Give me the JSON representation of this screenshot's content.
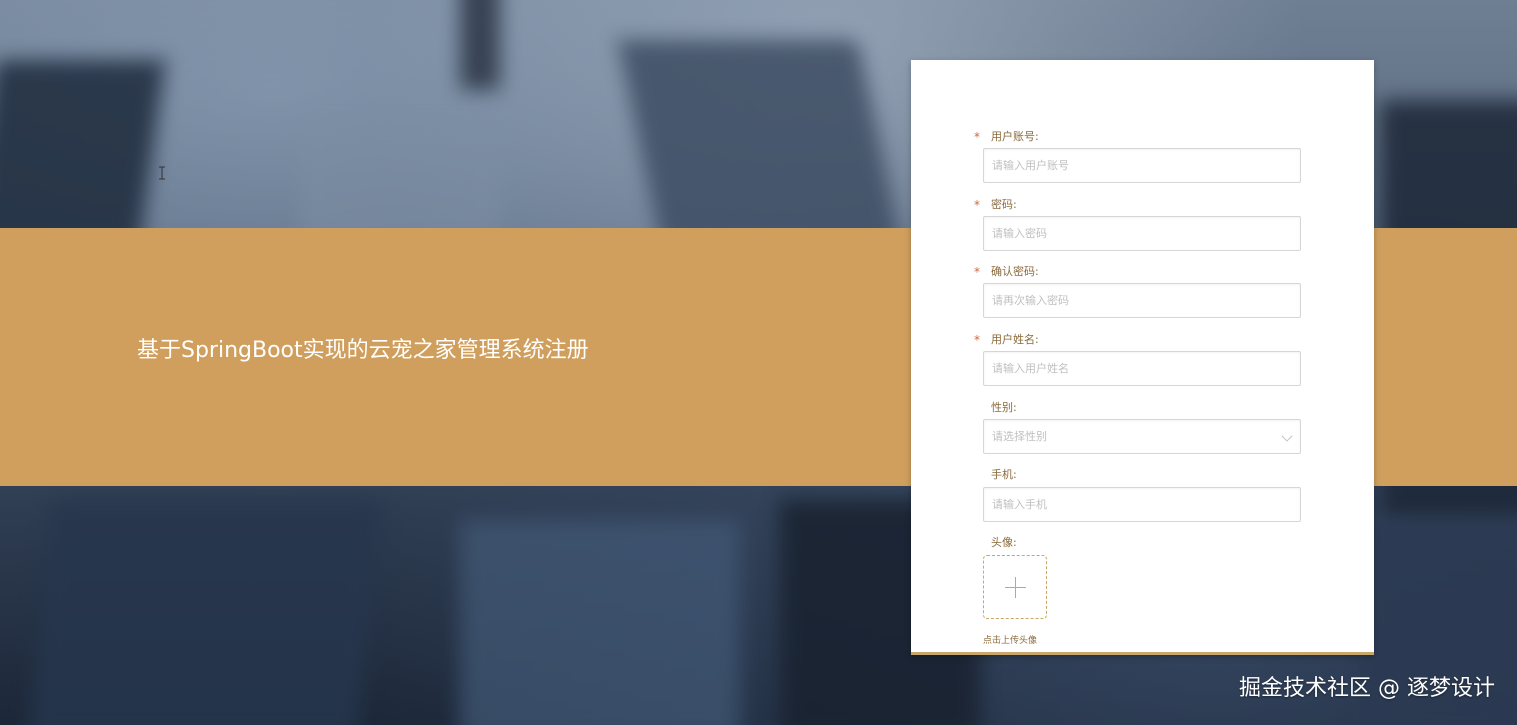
{
  "banner": {
    "title": "基于SpringBoot实现的云宠之家管理系统注册"
  },
  "form": {
    "fields": [
      {
        "label": "用户账号:",
        "required": true,
        "placeholder": "请输入用户账号"
      },
      {
        "label": "密码:",
        "required": true,
        "placeholder": "请输入密码"
      },
      {
        "label": "确认密码:",
        "required": true,
        "placeholder": "请再次输入密码"
      },
      {
        "label": "用户姓名:",
        "required": true,
        "placeholder": "请输入用户姓名"
      },
      {
        "label": "性别:",
        "required": false,
        "placeholder": "请选择性别"
      },
      {
        "label": "手机:",
        "required": false,
        "placeholder": "请输入手机"
      }
    ],
    "avatar": {
      "label": "头像:",
      "hint": "点击上传头像"
    },
    "required_mark": "*"
  },
  "watermark": "掘金技术社区 @ 逐梦设计",
  "colors": {
    "banner": "#d09f5e",
    "accent": "#c9a66b",
    "label": "#8a6a3c",
    "required": "#d0683a"
  },
  "icons": {
    "cursor": "text-cursor-icon",
    "chevron": "chevron-down-icon",
    "upload": "plus-icon"
  }
}
